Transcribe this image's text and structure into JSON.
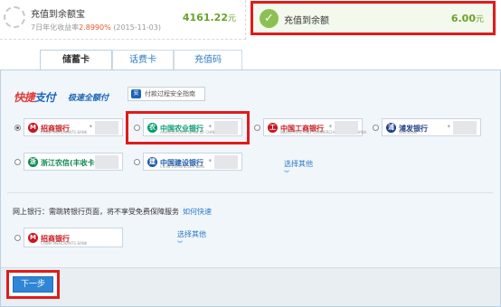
{
  "option_balance_treasure": {
    "title": "充值到余额宝",
    "yield_prefix": "7日年化收益率",
    "yield_rate": "2.8990%",
    "yield_date": "(2015-11-03)",
    "amount": "4161.22",
    "unit": "元"
  },
  "option_balance": {
    "title": "充值到余额",
    "amount": "6.00",
    "unit": "元",
    "selected": true
  },
  "tabs": [
    "储蓄卡",
    "话费卡",
    "充值码"
  ],
  "active_tab": 0,
  "quick_pay": {
    "logo_a": "快捷",
    "logo_b": "支付",
    "slogan": "极速全额付",
    "guide_label": "付款过程安全指南"
  },
  "bank_cards": [
    {
      "name": "招商银行",
      "sub": "CHINA MERCHANTS BANK",
      "color": "#c8161d",
      "selected": true,
      "mask": "*"
    },
    {
      "name": "中国农业银行",
      "sub": "AGRICULTURAL BANK OF CHINA",
      "color": "#009b6e",
      "selected": false,
      "mask": "*"
    },
    {
      "name": "中国工商银行",
      "sub": "INDUSTRIAL AND COMMERCIAL BANK OF CHINA",
      "color": "#c8161d",
      "selected": false,
      "mask": "*"
    },
    {
      "name": "浦发银行",
      "sub": "SPD BANK",
      "color": "#1d3f86",
      "selected": false,
      "mask": "*"
    },
    {
      "name": "浙江农信(丰收卡)",
      "sub": "",
      "color": "#0a8a4e",
      "selected": false,
      "mask": "*"
    },
    {
      "name": "中国建设银行",
      "sub": "China Construction Bank",
      "color": "#1c5aa8",
      "selected": false,
      "mask": "*"
    }
  ],
  "more_label": "选择其他",
  "online_bank": {
    "label": "网上银行：",
    "desc": "需跳转银行页面，将不享受免费保障服务",
    "link": "如何快速"
  },
  "online_card": {
    "name": "招商银行",
    "sub": "CHINA MERCHANTS BANK",
    "color": "#c8161d"
  },
  "next_button": "下一步"
}
